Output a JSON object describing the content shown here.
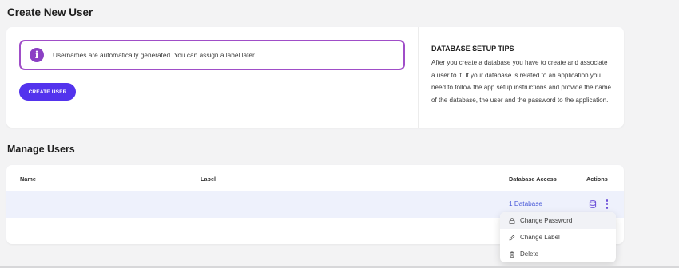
{
  "create_section": {
    "title": "Create New User",
    "notice_text": "Usernames are automatically generated. You can assign a label later.",
    "create_button_label": "CREATE USER"
  },
  "tips": {
    "title": "DATABASE SETUP TIPS",
    "body": "After you create a database you have to create and associate a user to it. If your database is related to an application you need to follow the app setup instructions and provide the name of the database, the user and the password to the application."
  },
  "manage_section": {
    "title": "Manage Users",
    "columns": {
      "name": "Name",
      "label": "Label",
      "database_access": "Database Access",
      "actions": "Actions"
    },
    "rows": [
      {
        "name": "",
        "label": "",
        "database_access": "1 Database"
      }
    ]
  },
  "actions_menu": {
    "items": [
      {
        "label": "Change Password",
        "icon": "lock-icon"
      },
      {
        "label": "Change Label",
        "icon": "pencil-icon"
      },
      {
        "label": "Delete",
        "icon": "trash-icon"
      }
    ]
  },
  "colors": {
    "accent": "#5333ed",
    "notice_border": "#a04ec8",
    "link": "#4a5bd8",
    "row_highlight": "#eef1fc"
  }
}
